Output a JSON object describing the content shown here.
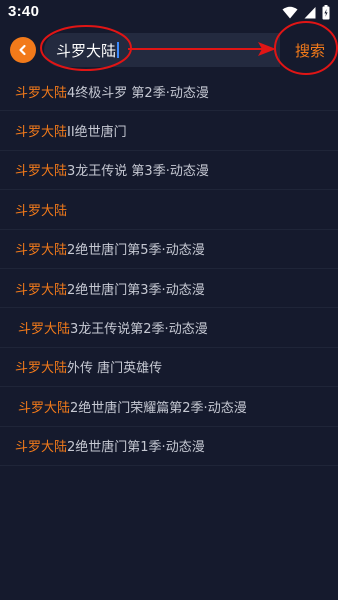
{
  "status_bar": {
    "time": "3:40",
    "icons": [
      "wifi-icon",
      "signal-icon",
      "battery-icon"
    ]
  },
  "search": {
    "query": "斗罗大陆",
    "search_label": "搜索",
    "back_icon": "chevron-left-icon"
  },
  "suggestions": [
    {
      "highlight": "斗罗大陆",
      "rest": "4终极斗罗 第2季·动态漫"
    },
    {
      "highlight": "斗罗大陆",
      "rest": "II绝世唐门"
    },
    {
      "highlight": "斗罗大陆",
      "rest": "3龙王传说 第3季·动态漫"
    },
    {
      "highlight": "斗罗大陆",
      "rest": ""
    },
    {
      "highlight": "斗罗大陆",
      "rest": "2绝世唐门第5季·动态漫"
    },
    {
      "highlight": "斗罗大陆",
      "rest": "2绝世唐门第3季·动态漫"
    },
    {
      "highlight": "斗罗大陆",
      "rest": "3龙王传说第2季·动态漫"
    },
    {
      "highlight": "斗罗大陆",
      "rest": "外传 唐门英雄传"
    },
    {
      "highlight": "斗罗大陆",
      "rest": "2绝世唐门荣耀篇第2季·动态漫"
    },
    {
      "highlight": "斗罗大陆",
      "rest": "2绝世唐门第1季·动态漫"
    }
  ],
  "colors": {
    "background": "#151a2d",
    "accent": "#f27a1a",
    "annotation": "#e01515"
  }
}
